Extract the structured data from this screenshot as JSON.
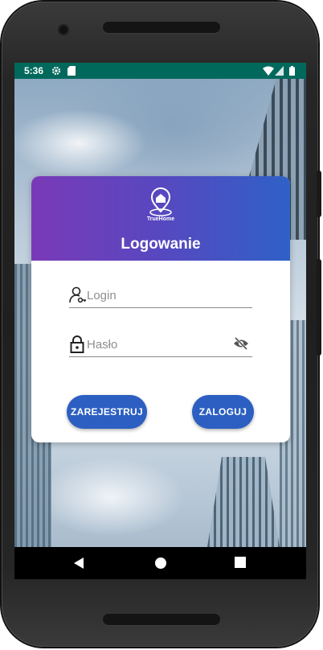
{
  "status_bar": {
    "time": "5:36",
    "icons": [
      "gear-icon",
      "sd-card-icon",
      "wifi-icon",
      "signal-icon",
      "battery-icon"
    ],
    "color": "#00695c"
  },
  "card": {
    "logo_text": "TrueHome",
    "title": "Logowanie",
    "header_gradient": [
      "#7a3ab7",
      "#2f61c7"
    ]
  },
  "form": {
    "login": {
      "placeholder": "Login",
      "value": "",
      "icon": "user-key-icon"
    },
    "password": {
      "placeholder": "Hasło",
      "value": "",
      "icon": "lock-icon",
      "toggle_icon": "eye-off-icon"
    }
  },
  "buttons": {
    "register": "ZAREJESTRUJ",
    "login": "ZALOGUJ",
    "color": "#2c5fc1"
  },
  "nav_bar": {
    "items": [
      "back-icon",
      "home-icon",
      "recents-icon"
    ]
  }
}
